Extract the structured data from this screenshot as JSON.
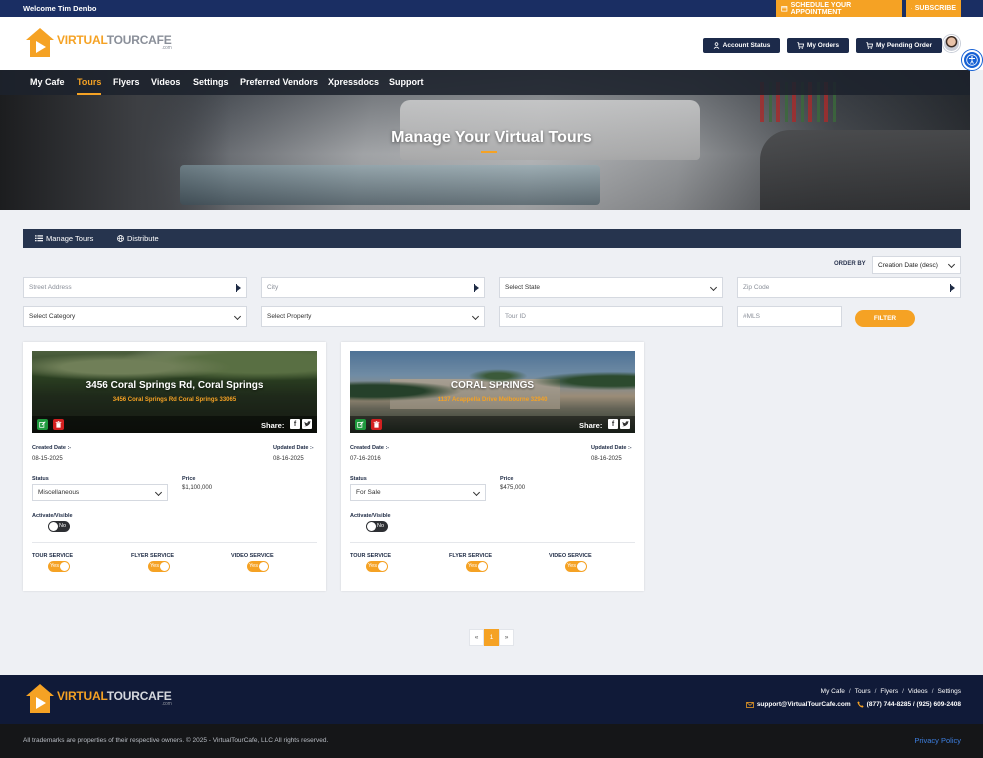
{
  "topbar": {
    "welcome": "Welcome Tim Denbo",
    "schedule_label": "SCHEDULE YOUR APPOINTMENT",
    "subscribe_label": "SUBSCRIBE"
  },
  "brand": {
    "name_part1": "VIRTUAL",
    "name_part2": "TOURCAFE",
    "suffix": ".com",
    "accent": "#f5a224",
    "navy": "#1c2a4a"
  },
  "header": {
    "account_status": "Account Status",
    "my_orders": "My Orders",
    "pending_order": "My Pending Order"
  },
  "nav": {
    "items": [
      "My Cafe",
      "Tours",
      "Flyers",
      "Videos",
      "Settings",
      "Preferred Vendors",
      "Xpressdocs",
      "Support"
    ],
    "active": "Tours"
  },
  "hero": {
    "title": "Manage Your Virtual Tours"
  },
  "tabs": {
    "manage": "Manage Tours",
    "distribute": "Distribute"
  },
  "filters": {
    "order_by_label": "ORDER BY",
    "order_by_value": "Creation Date (desc)",
    "street_placeholder": "Street Address",
    "city_placeholder": "City",
    "state_placeholder": "Select State",
    "zip_placeholder": "Zip Code",
    "category_placeholder": "Select Category",
    "property_placeholder": "Select Property",
    "tour_id_placeholder": "Tour ID",
    "mls_placeholder": "#MLS",
    "filter_button": "FILTER"
  },
  "card_labels": {
    "created": "Created Date :-",
    "updated": "Updated Date :-",
    "status": "Status",
    "price": "Price",
    "activate": "Activate/Visible",
    "no": "No",
    "yes": "Yes",
    "share": "Share:",
    "tour_service": "TOUR SERVICE",
    "flyer_service": "FLYER SERVICE",
    "video_service": "VIDEO SERVICE"
  },
  "tours": [
    {
      "title": "3456 Coral Springs Rd, Coral Springs",
      "address": "3456 Coral Springs Rd Coral Springs 33065",
      "created": "08-15-2025",
      "updated": "08-16-2025",
      "status": "Miscellaneous",
      "price": "$1,100,000"
    },
    {
      "title": "CORAL SPRINGS",
      "address": "1137 Acappella Drive Melbourne 32940",
      "created": "07-16-2016",
      "updated": "08-16-2025",
      "status": "For Sale",
      "price": "$475,000"
    }
  ],
  "pagination": {
    "prev": "«",
    "current": "1",
    "next": "»"
  },
  "footer": {
    "links": [
      "My Cafe",
      "Tours",
      "Flyers",
      "Videos",
      "Settings"
    ],
    "email": "support@VirtualTourCafe.com",
    "phone": "(877) 744-8285 / (925) 609-2408",
    "copyright": "All trademarks are properties of their respective owners. © 2025 - VirtualTourCafe, LLC All rights reserved.",
    "privacy": "Privacy Policy"
  }
}
